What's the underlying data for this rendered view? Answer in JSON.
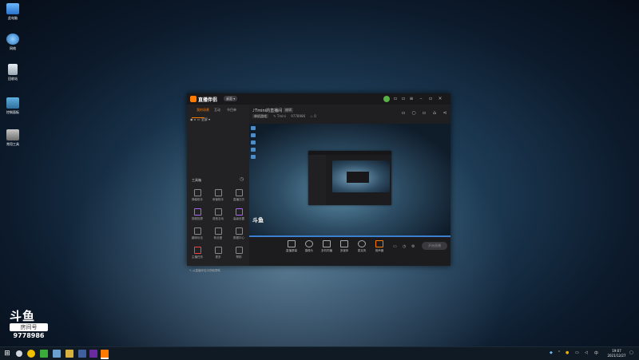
{
  "desktop": {
    "icons": [
      {
        "label": "此电脑",
        "icon": "computer-icon"
      },
      {
        "label": "网络",
        "icon": "network-icon"
      },
      {
        "label": "回收站",
        "icon": "recycle-bin-icon"
      },
      {
        "label": "控制面板",
        "icon": "control-panel-icon"
      },
      {
        "label": "常用工具",
        "icon": "tools-icon"
      }
    ]
  },
  "watermark": {
    "logo": "斗鱼",
    "room_label": "房间号",
    "room_number": "9778986"
  },
  "app": {
    "title": "直播伴侣",
    "version_badge": "桌面 ▾",
    "tabs": [
      "我的场景",
      "互动",
      "节目单"
    ],
    "scene_row": "全屏 ▾",
    "tools_title": "工具箱",
    "tools_settings": "◷",
    "tools": [
      {
        "label": "弹幕助手",
        "icon": "danmaku-icon"
      },
      {
        "label": "房管助手",
        "icon": "admin-icon"
      },
      {
        "label": "直播日历",
        "icon": "calendar-icon"
      },
      {
        "label": "视频投屏",
        "icon": "cast-icon"
      },
      {
        "label": "语音互动",
        "icon": "voice-icon"
      },
      {
        "label": "高级设置",
        "icon": "settings-icon"
      },
      {
        "label": "趣味玩法",
        "icon": "play-icon"
      },
      {
        "label": "粉丝团",
        "icon": "fans-icon"
      },
      {
        "label": "数据中心",
        "icon": "data-icon"
      },
      {
        "label": "主播任务",
        "icon": "task-icon"
      },
      {
        "label": "更多",
        "icon": "more-icon"
      },
      {
        "label": "帮助",
        "icon": "help-icon"
      }
    ],
    "left_bottom": "✎ 从直播伴侣中获取帮助",
    "room": {
      "title": "♪Tmini的直播间",
      "tag": "编辑",
      "category": "单机游戏",
      "sub_items": [
        "✎ Tmini",
        "9778986",
        "♨ 0"
      ]
    },
    "preview_watermark": "斗鱼",
    "bottom_bar": [
      {
        "label": "直播屏幕",
        "icon": "monitor-icon"
      },
      {
        "label": "摄像头",
        "icon": "camera-icon"
      },
      {
        "label": "多机同播",
        "icon": "multi-icon"
      },
      {
        "label": "多媒体",
        "icon": "media-icon"
      },
      {
        "label": "麦克风",
        "icon": "mic-icon"
      },
      {
        "label": "扬声器",
        "icon": "speaker-icon"
      }
    ],
    "live_button": "开始直播"
  },
  "taskbar": {
    "start": "⊞",
    "clock_time": "19:07",
    "clock_date": "2021/12/27"
  }
}
